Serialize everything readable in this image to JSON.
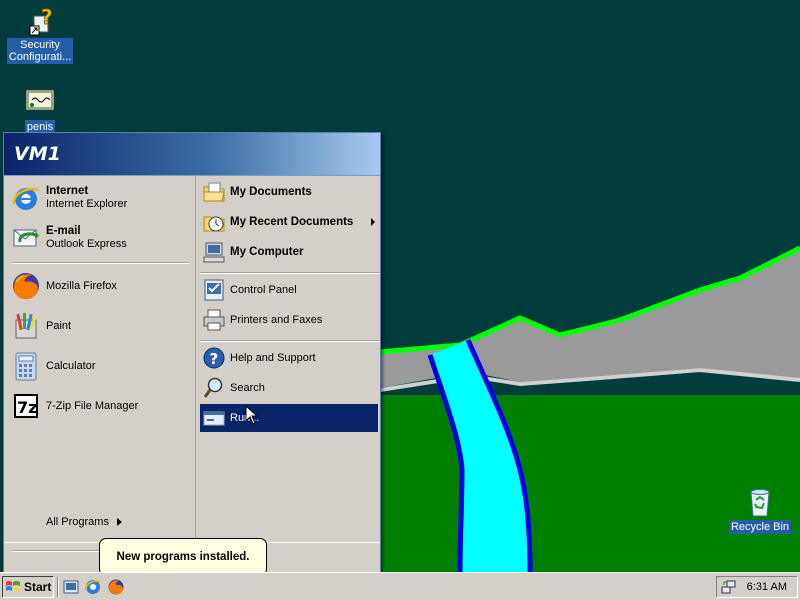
{
  "desktop": {
    "icons": [
      {
        "label_line1": "Security",
        "label_line2": "Configurati..."
      },
      {
        "label_line1": "penis",
        "label_line2": ""
      },
      {
        "label_line1": "Recycle Bin",
        "label_line2": ""
      }
    ]
  },
  "start_menu": {
    "user": "VM1",
    "pinned": [
      {
        "title": "Internet",
        "subtitle": "Internet Explorer"
      },
      {
        "title": "E-mail",
        "subtitle": "Outlook Express"
      }
    ],
    "recent": [
      {
        "label": "Mozilla Firefox"
      },
      {
        "label": "Paint"
      },
      {
        "label": "Calculator"
      },
      {
        "label": "7-Zip File Manager"
      }
    ],
    "all_programs": "All Programs",
    "right": [
      {
        "label": "My Documents"
      },
      {
        "label": "My Recent Documents"
      },
      {
        "label": "My Computer"
      },
      {
        "label": "Control Panel"
      },
      {
        "label": "Printers and Faxes"
      },
      {
        "label": "Help and Support"
      },
      {
        "label": "Search"
      },
      {
        "label": "Run..."
      }
    ]
  },
  "balloon": {
    "text": "New programs installed."
  },
  "taskbar": {
    "start_label": "Start",
    "clock": "6:31 AM"
  },
  "colors": {
    "sky": "#023c3c",
    "grass": "#008000",
    "river": "#00ffff",
    "river_edge": "#0000e0",
    "ridge": "#00ff00",
    "selection": "#0a246a"
  }
}
